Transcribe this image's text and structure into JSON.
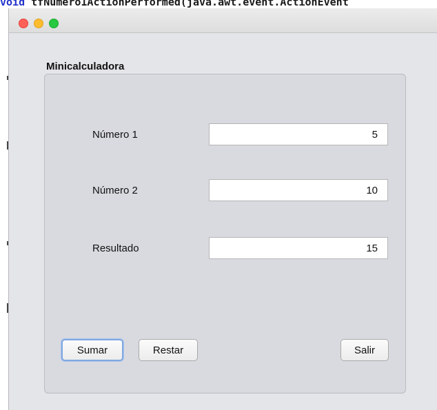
{
  "background_code": {
    "keyword": "void",
    "text": " tfNumero1ActionPerformed(java.awt.event.ActionEvent"
  },
  "window": {
    "panel_title": "Minicalculadora",
    "fields": [
      {
        "label": "Número 1",
        "value": "5"
      },
      {
        "label": "Número 2",
        "value": "10"
      },
      {
        "label": "Resultado",
        "value": "15"
      }
    ],
    "buttons": {
      "sumar": "Sumar",
      "restar": "Restar",
      "salir": "Salir"
    }
  },
  "colors": {
    "close": "#fe5f57",
    "minimize": "#febc2e",
    "maximize": "#28c840",
    "focus_ring": "#7fa8e0"
  }
}
